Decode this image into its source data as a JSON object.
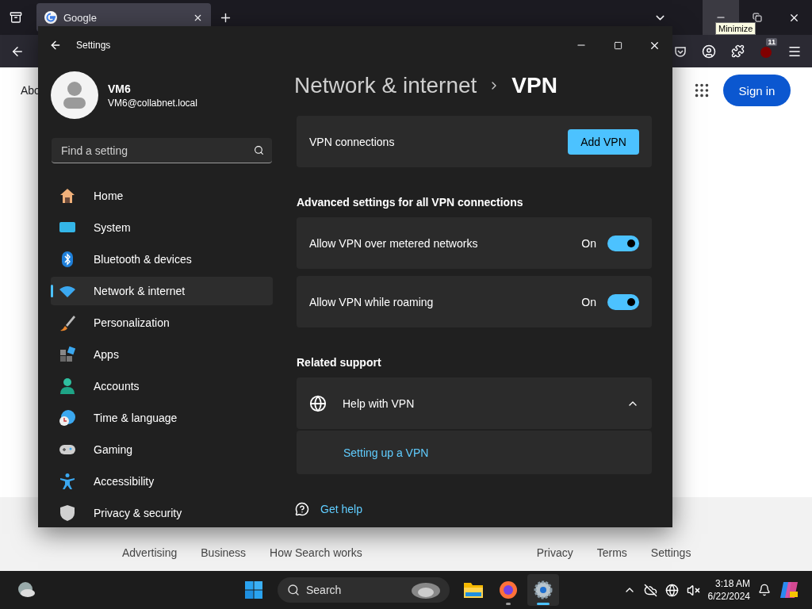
{
  "browser": {
    "tabs": [
      {
        "label": "Google",
        "selected": true
      }
    ],
    "minimize_hovered": true,
    "tooltip": "Minimize",
    "extension_badge": "11",
    "page": {
      "top_link": "Abo",
      "sign_in": "Sign in",
      "footer_left": [
        "Advertising",
        "Business",
        "How Search works"
      ],
      "footer_right": [
        "Privacy",
        "Terms",
        "Settings"
      ]
    }
  },
  "settings": {
    "title": "Settings",
    "user": {
      "name": "VM6",
      "email": "VM6@collabnet.local"
    },
    "search": {
      "placeholder": "Find a setting"
    },
    "nav": [
      {
        "label": "Home",
        "selected": false
      },
      {
        "label": "System",
        "selected": false
      },
      {
        "label": "Bluetooth & devices",
        "selected": false
      },
      {
        "label": "Network & internet",
        "selected": true
      },
      {
        "label": "Personalization",
        "selected": false
      },
      {
        "label": "Apps",
        "selected": false
      },
      {
        "label": "Accounts",
        "selected": false
      },
      {
        "label": "Time & language",
        "selected": false
      },
      {
        "label": "Gaming",
        "selected": false
      },
      {
        "label": "Accessibility",
        "selected": false
      },
      {
        "label": "Privacy & security",
        "selected": false
      }
    ],
    "breadcrumb": [
      "Network & internet",
      "VPN"
    ],
    "vpn_connections": {
      "label": "VPN connections",
      "button": "Add VPN"
    },
    "advanced": {
      "heading": "Advanced settings for all VPN connections",
      "rows": [
        {
          "label": "Allow VPN over metered networks",
          "state_text": "On",
          "on": true
        },
        {
          "label": "Allow VPN while roaming",
          "state_text": "On",
          "on": true
        }
      ]
    },
    "related_support": {
      "heading": "Related support",
      "help": {
        "title": "Help with VPN",
        "expanded": true,
        "links": [
          "Setting up a VPN"
        ]
      }
    },
    "get_help": "Get help"
  },
  "taskbar": {
    "search": {
      "placeholder": "Search"
    },
    "apps": [
      {
        "running": false,
        "active": false
      },
      {
        "running": true,
        "active": false
      },
      {
        "running": true,
        "active": true
      }
    ],
    "clock": {
      "time": "3:18 AM",
      "date": "6/22/2024"
    }
  }
}
